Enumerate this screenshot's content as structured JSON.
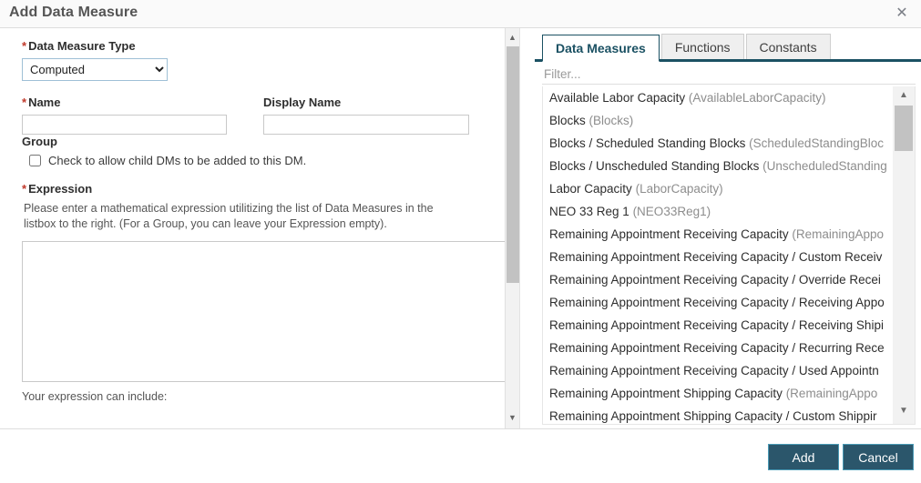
{
  "dialog": {
    "title": "Add Data Measure",
    "close_icon": "close-icon"
  },
  "form": {
    "type_label": "Data Measure Type",
    "type_value": "Computed",
    "type_options": [
      "Computed"
    ],
    "name_label": "Name",
    "name_value": "",
    "name_placeholder": "",
    "display_name_label": "Display Name",
    "display_name_value": "",
    "display_name_placeholder": "",
    "group_label": "Group",
    "group_checkbox_label": "Check to allow child DMs to be added to this DM.",
    "group_checked": false,
    "expression_label": "Expression",
    "expression_help": "Please enter a mathematical expression utilitizing the list of Data Measures in the listbox to the right. (For a Group, you can leave your Expression empty).",
    "expression_value": "",
    "expression_placeholder": "",
    "include_text": "Your expression can include:",
    "required_marker": "*"
  },
  "right_panel": {
    "tabs": [
      {
        "label": "Data Measures",
        "active": true
      },
      {
        "label": "Functions",
        "active": false
      },
      {
        "label": "Constants",
        "active": false
      }
    ],
    "filter_placeholder": "Filter...",
    "filter_value": "",
    "items": [
      {
        "name": "Available Labor Capacity",
        "code": "(AvailableLaborCapacity)"
      },
      {
        "name": "Blocks",
        "code": "(Blocks)"
      },
      {
        "name": "Blocks / Scheduled Standing Blocks",
        "code": "(ScheduledStandingBloc"
      },
      {
        "name": "Blocks / Unscheduled Standing Blocks",
        "code": "(UnscheduledStanding"
      },
      {
        "name": "Labor Capacity",
        "code": "(LaborCapacity)"
      },
      {
        "name": "NEO 33 Reg 1",
        "code": "(NEO33Reg1)"
      },
      {
        "name": "Remaining Appointment Receiving Capacity",
        "code": "(RemainingAppo"
      },
      {
        "name": "Remaining Appointment Receiving Capacity / Custom Receiv",
        "code": ""
      },
      {
        "name": "Remaining Appointment Receiving Capacity / Override Recei",
        "code": ""
      },
      {
        "name": "Remaining Appointment Receiving Capacity / Receiving Appo",
        "code": ""
      },
      {
        "name": "Remaining Appointment Receiving Capacity / Receiving Shipi",
        "code": ""
      },
      {
        "name": "Remaining Appointment Receiving Capacity / Recurring Rece",
        "code": ""
      },
      {
        "name": "Remaining Appointment Receiving Capacity / Used Appointn",
        "code": ""
      },
      {
        "name": "Remaining Appointment Shipping Capacity",
        "code": "(RemainingAppo"
      },
      {
        "name": "Remaining Appointment Shipping Capacity / Custom Shippir",
        "code": ""
      }
    ]
  },
  "scrollbars": {
    "left_up_icon": "▲",
    "left_down_icon": "▼",
    "right_up_icon": "▲",
    "right_down_icon": "▼"
  },
  "footer": {
    "add_label": "Add",
    "cancel_label": "Cancel"
  },
  "colors": {
    "accent": "#1b5163",
    "button": "#2b566b",
    "required": "#c0392b"
  }
}
